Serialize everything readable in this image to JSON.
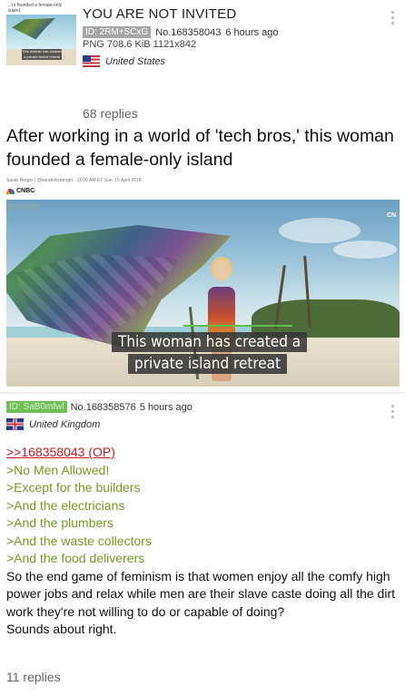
{
  "op": {
    "thumbnail": {
      "caption": "...rs founded a female-only island",
      "label": "This woman has created a private island retreat"
    },
    "subject": "YOU ARE NOT INVITED",
    "id_badge": "ID: 2RM+SCxG",
    "post_no": "No.168358043",
    "time": "6 hours ago",
    "file_info": "PNG 708.6 KiB 1121x842",
    "country": "United States",
    "replies": "68 replies",
    "image": {
      "headline": "After working in a world of 'tech bros,' this woman founded a female-only island",
      "byline": "Sarah Berger | @saraholizberger · 11:00 AM ET Sun, 15 April 2018",
      "source": "CNBC",
      "video_caption_line1": "This woman has created a",
      "video_caption_line2": "private island retreat",
      "bug": "CN"
    }
  },
  "reply": {
    "id_badge": "ID: SaB0mfwl",
    "post_no": "No.168358576",
    "time": "5 hours ago",
    "country": "United Kingdom",
    "quote_link": ">>168358043 (OP)",
    "greentext": [
      ">No Men Allowed!",
      ">Except for the builders",
      ">And the electricians",
      ">And the plumbers",
      ">And the waste collectors",
      ">And the food deliverers"
    ],
    "text": [
      "So the end game of feminism is that women enjoy all the comfy high power jobs and relax while men are their slave caste doing all the dirt work they're not willing to do or capable of doing?",
      "Sounds about right."
    ],
    "replies": "11 replies"
  },
  "colors": {
    "greentext": "#789922",
    "quotelink": "#d0191f",
    "id_badge_op": "#a6a6a6",
    "id_badge_reply": "#6fbf57"
  },
  "icons": [
    "more-vert-icon",
    "flag-us-icon",
    "flag-uk-icon",
    "cnbc-peacock-icon"
  ]
}
